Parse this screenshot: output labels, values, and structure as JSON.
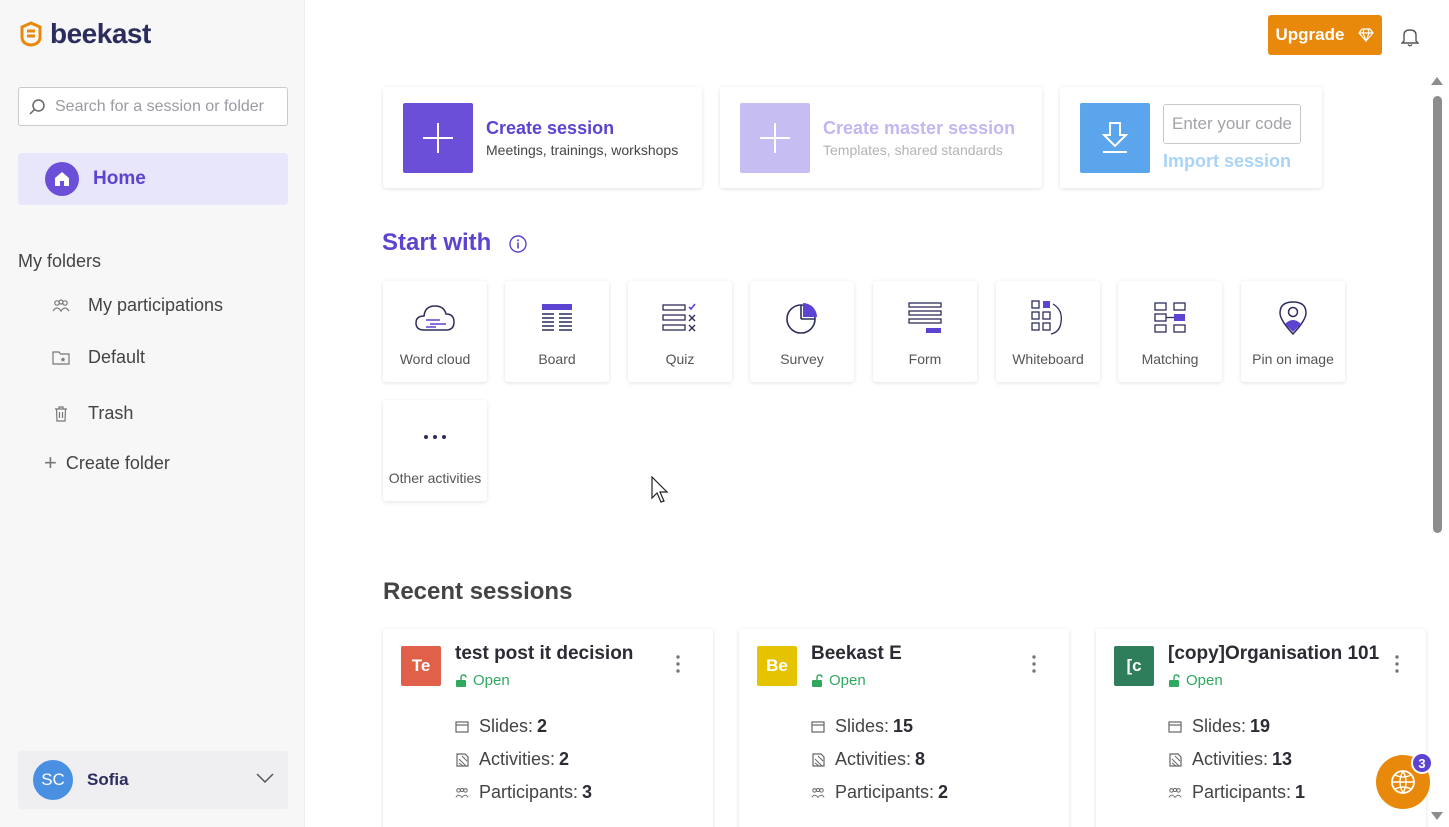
{
  "brand": {
    "name": "beekast"
  },
  "search": {
    "placeholder": "Search for a session or folder"
  },
  "nav": {
    "home_label": "Home"
  },
  "folders": {
    "title": "My folders",
    "items": [
      {
        "label": "My participations",
        "icon": "participants-icon"
      },
      {
        "label": "Default",
        "icon": "folder-star-icon"
      },
      {
        "label": "Trash",
        "icon": "trash-icon"
      }
    ],
    "create_label": "Create folder"
  },
  "user": {
    "initials": "SC",
    "name": "Sofia"
  },
  "header": {
    "upgrade_label": "Upgrade"
  },
  "create": {
    "session": {
      "title": "Create session",
      "subtitle": "Meetings, trainings, workshops"
    },
    "master": {
      "title": "Create master session",
      "subtitle": "Templates, shared standards"
    },
    "import": {
      "placeholder": "Enter your code",
      "label": "Import session"
    }
  },
  "start_with": {
    "title": "Start with",
    "activities": [
      {
        "label": "Word cloud",
        "icon": "word-cloud-icon"
      },
      {
        "label": "Board",
        "icon": "board-icon"
      },
      {
        "label": "Quiz",
        "icon": "quiz-icon"
      },
      {
        "label": "Survey",
        "icon": "survey-pie-icon"
      },
      {
        "label": "Form",
        "icon": "form-icon"
      },
      {
        "label": "Whiteboard",
        "icon": "whiteboard-icon"
      },
      {
        "label": "Matching",
        "icon": "matching-icon"
      },
      {
        "label": "Pin on image",
        "icon": "pin-on-image-icon"
      },
      {
        "label": "Other activities",
        "icon": "more-dots-icon"
      }
    ]
  },
  "recent": {
    "title": "Recent sessions",
    "labels": {
      "slides": "Slides:",
      "activities": "Activities:",
      "participants": "Participants:"
    },
    "sessions": [
      {
        "badge": "Te",
        "badge_color": "#e0604a",
        "title": "test post it decision",
        "status": "Open",
        "slides": "2",
        "activities": "2",
        "participants": "3"
      },
      {
        "badge": "Be",
        "badge_color": "#e6c300",
        "title": "Beekast E",
        "status": "Open",
        "slides": "15",
        "activities": "8",
        "participants": "2"
      },
      {
        "badge": "[c",
        "badge_color": "#2e7d5b",
        "title": "[copy]Organisation 101",
        "status": "Open",
        "slides": "19",
        "activities": "13",
        "participants": "1"
      }
    ]
  },
  "help": {
    "badge_count": "3"
  },
  "colors": {
    "accent": "#5d43d1",
    "orange": "#e8890c",
    "open": "#2fa860"
  }
}
